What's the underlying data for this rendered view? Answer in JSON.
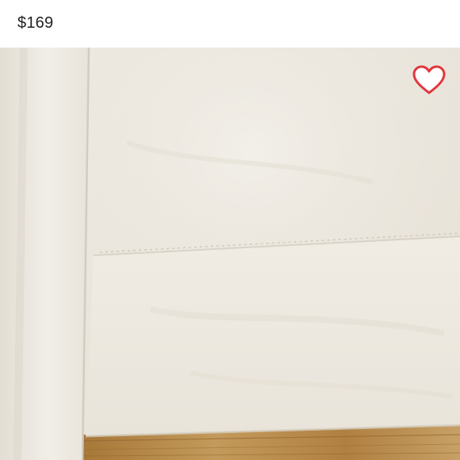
{
  "listing": {
    "price": "$169"
  },
  "colors": {
    "heart_stroke": "#e0383e",
    "heart_fill": "#ffffff",
    "fabric": "#ece8df",
    "wood": "#b98a4a"
  },
  "icons": {
    "like": "heart-outline-icon"
  }
}
